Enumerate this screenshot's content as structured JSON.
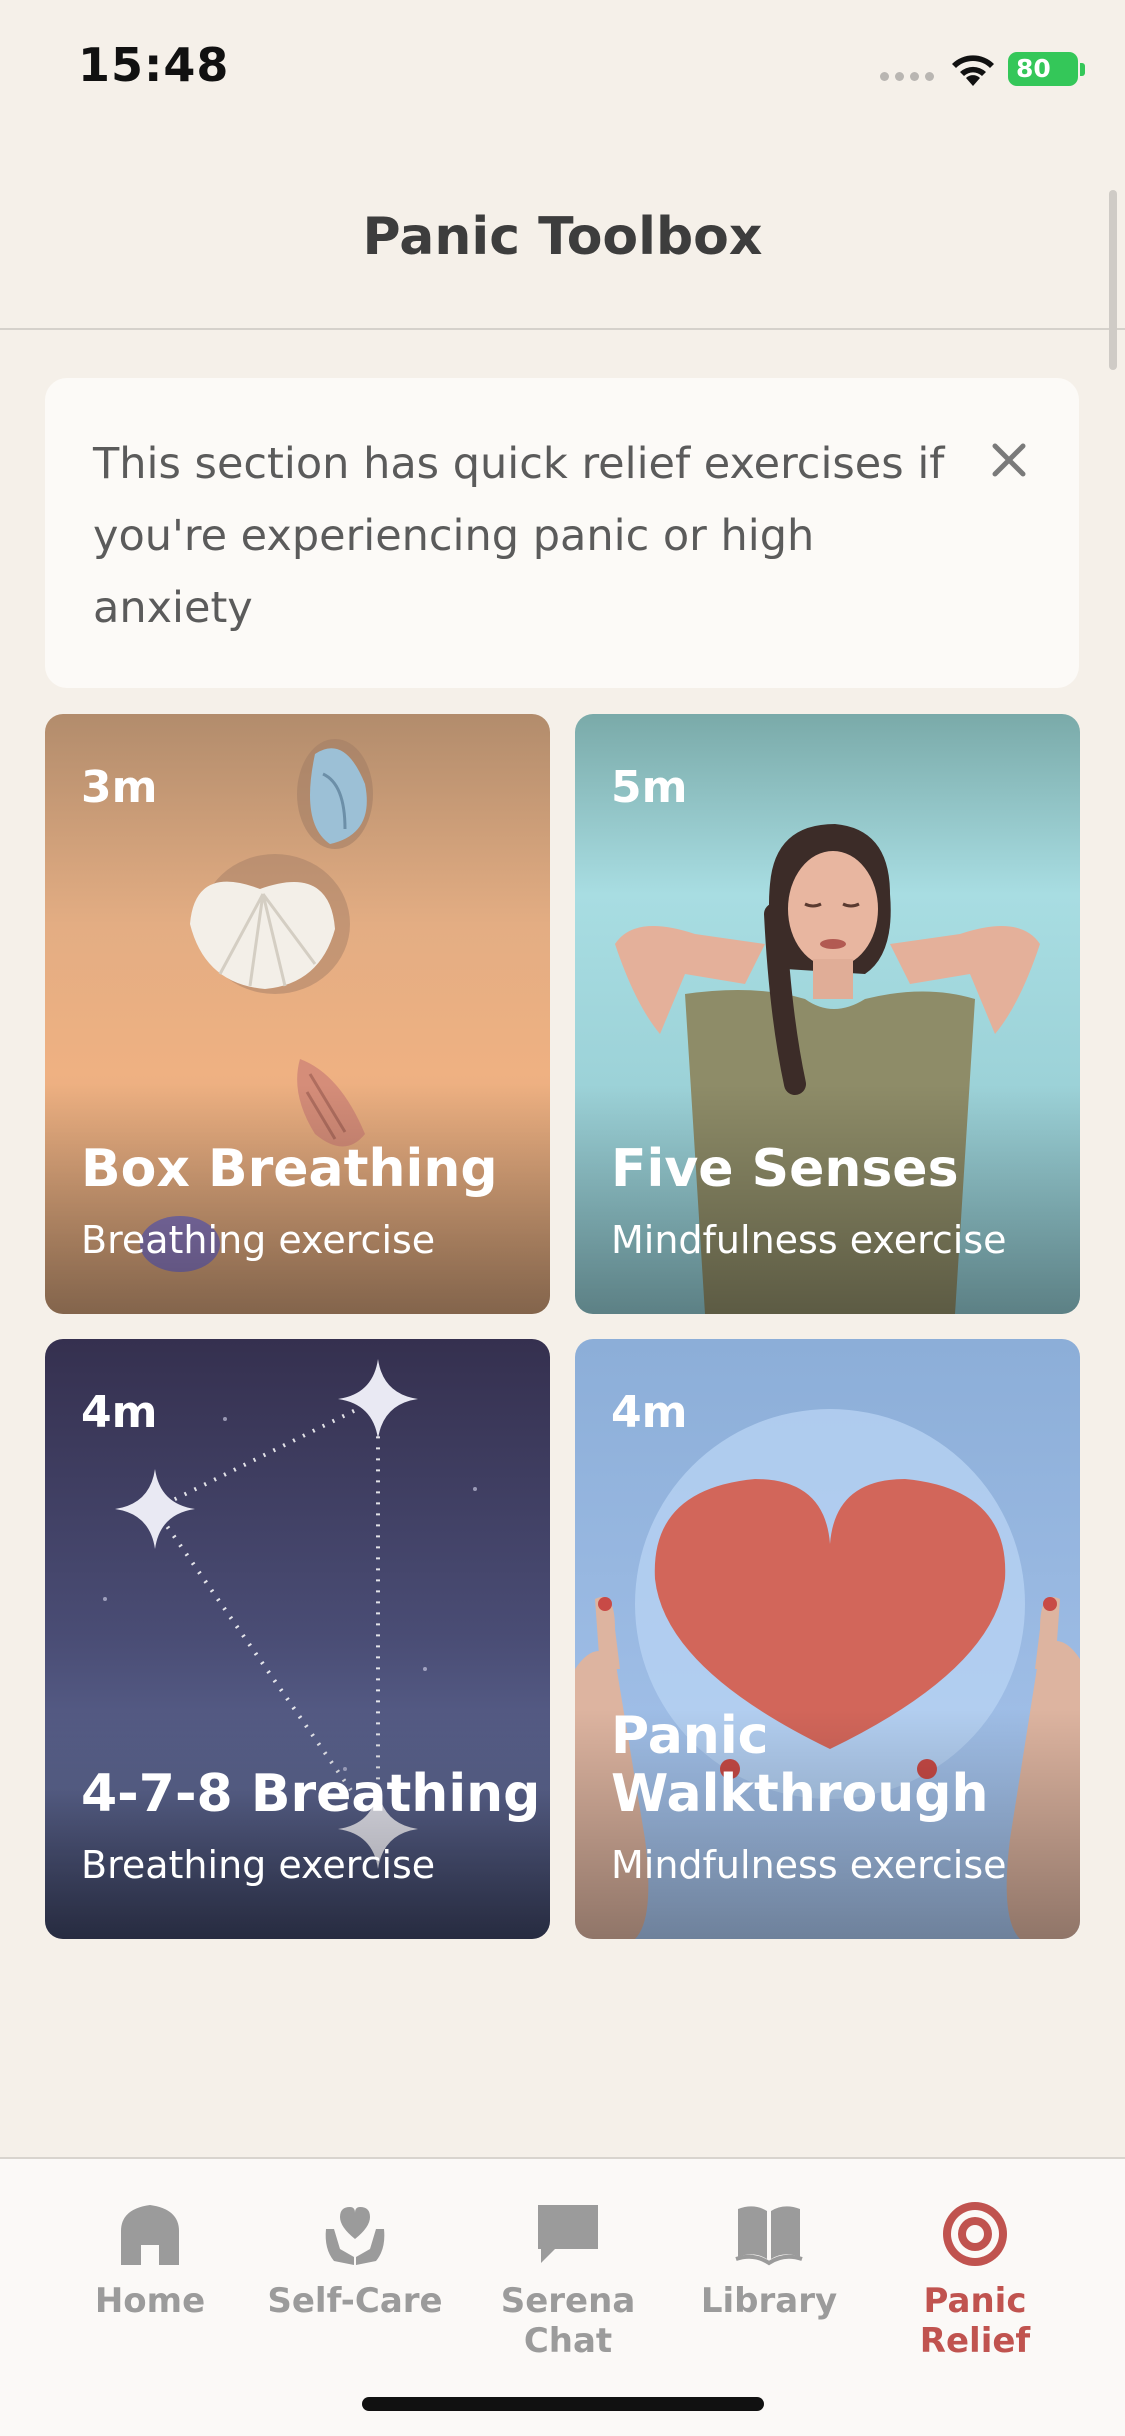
{
  "status_bar": {
    "time": "15:48",
    "battery": "80"
  },
  "header": {
    "title": "Panic Toolbox"
  },
  "info_banner": {
    "text": "This section has quick relief exercises if you're experiencing panic or high anxiety",
    "close_icon": "close-icon"
  },
  "cards": [
    {
      "duration": "3m",
      "title": "Box Breathing",
      "subtitle": "Breathing exercise",
      "illustration": "seashells-on-sand"
    },
    {
      "duration": "5m",
      "title": "Five Senses",
      "subtitle": "Mindfulness exercise",
      "illustration": "relaxed-woman"
    },
    {
      "duration": "4m",
      "title": "4-7-8 Breathing",
      "subtitle": "Breathing exercise",
      "illustration": "star-constellation"
    },
    {
      "duration": "4m",
      "title": "Panic Walkthrough",
      "subtitle": "Mindfulness exercise",
      "illustration": "hands-holding-heart"
    }
  ],
  "tab_bar": {
    "active": "Panic Relief",
    "items": [
      {
        "label": "Home",
        "icon": "home-icon"
      },
      {
        "label": "Self-Care",
        "icon": "heart-hands-icon"
      },
      {
        "label": "Serena Chat",
        "icon": "chat-bubble-icon"
      },
      {
        "label": "Library",
        "icon": "book-icon"
      },
      {
        "label": "Panic Relief",
        "icon": "target-icon"
      }
    ]
  },
  "colors": {
    "background": "#f5f0e9",
    "accent": "#c0534f",
    "inactive_tab": "#9b9b9b",
    "battery": "#34c759"
  }
}
